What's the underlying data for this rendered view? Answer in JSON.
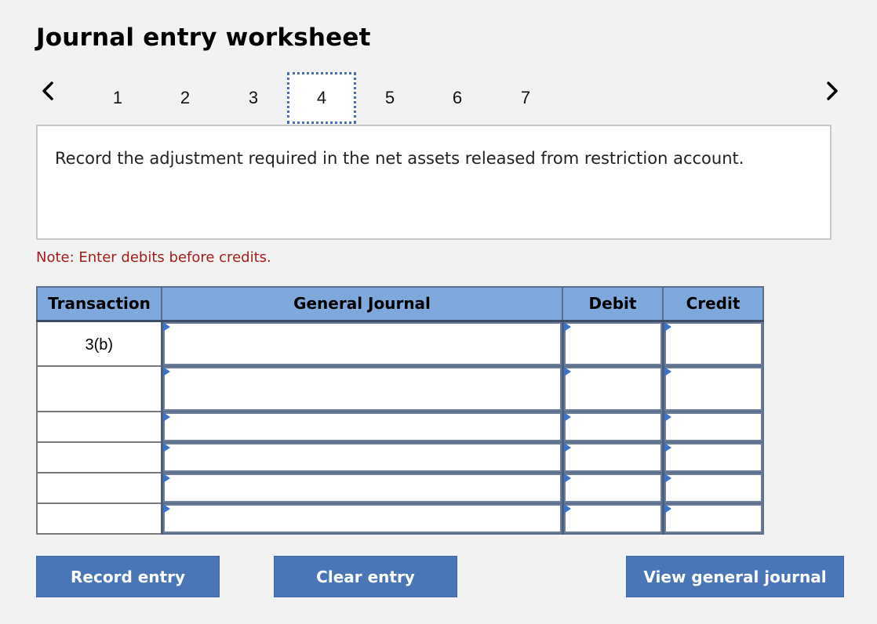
{
  "title": "Journal entry worksheet",
  "pager": {
    "steps": [
      "1",
      "2",
      "3",
      "4",
      "5",
      "6",
      "7"
    ],
    "active": "4"
  },
  "prompt": "Record the adjustment required in the net assets released from restriction account.",
  "note": "Note: Enter debits before credits.",
  "table": {
    "headers": {
      "transaction": "Transaction",
      "general_journal": "General Journal",
      "debit": "Debit",
      "credit": "Credit"
    },
    "rows": [
      {
        "transaction": "3(b)",
        "account": "",
        "debit": "",
        "credit": ""
      },
      {
        "transaction": "",
        "account": "",
        "debit": "",
        "credit": ""
      },
      {
        "transaction": "",
        "account": "",
        "debit": "",
        "credit": ""
      },
      {
        "transaction": "",
        "account": "",
        "debit": "",
        "credit": ""
      },
      {
        "transaction": "",
        "account": "",
        "debit": "",
        "credit": ""
      },
      {
        "transaction": "",
        "account": "",
        "debit": "",
        "credit": ""
      }
    ]
  },
  "buttons": {
    "record": "Record entry",
    "clear": "Clear entry",
    "view": "View general journal"
  },
  "icons": {
    "prev": "chevron-left-icon",
    "next": "chevron-right-icon",
    "cell_marker": "dropdown-marker-icon"
  },
  "colors": {
    "header_bg": "#7fa8dc",
    "button_bg": "#4a76b7",
    "note_text": "#a61c1c"
  }
}
